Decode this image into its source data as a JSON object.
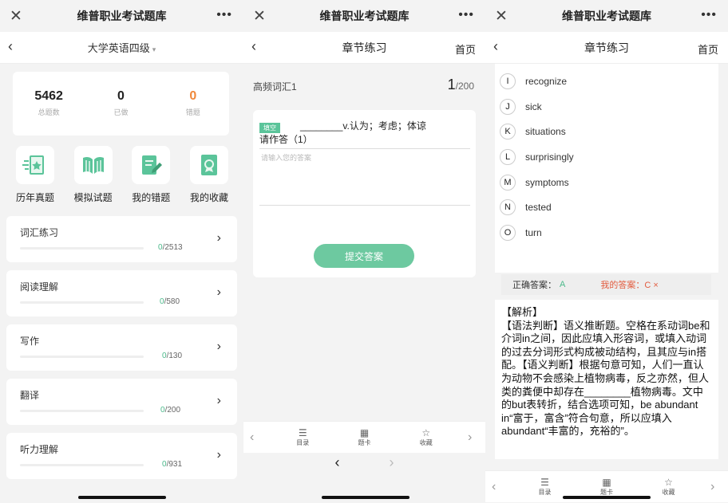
{
  "app_title": "维普职业考试题库",
  "p1": {
    "nav_title": "大学英语四级",
    "stats": [
      {
        "value": "5462",
        "label": "总题数"
      },
      {
        "value": "0",
        "label": "已做"
      },
      {
        "value": "0",
        "label": "错题"
      }
    ],
    "quick": [
      {
        "label": "历年真题",
        "icon": "exam-paper-icon"
      },
      {
        "label": "模拟试题",
        "icon": "book-icon"
      },
      {
        "label": "我的错题",
        "icon": "edit-note-icon"
      },
      {
        "label": "我的收藏",
        "icon": "favorite-badge-icon"
      }
    ],
    "sections": [
      {
        "title": "词汇练习",
        "done": "0",
        "total": "/2513"
      },
      {
        "title": "阅读理解",
        "done": "0",
        "total": "/580"
      },
      {
        "title": "写作",
        "done": "0",
        "total": "/130"
      },
      {
        "title": "翻译",
        "done": "0",
        "total": "/200"
      },
      {
        "title": "听力理解",
        "done": "0",
        "total": "/931"
      }
    ]
  },
  "p2": {
    "nav_title": "章节练习",
    "home": "首页",
    "question_group": "高频词汇1",
    "current": "1",
    "total": "/200",
    "tag": "填空",
    "question": "________v.认为；考虑；体谅",
    "instruction": "请作答（1）",
    "placeholder": "请输入您的答案",
    "submit": "提交答案",
    "bottom": {
      "catalog": "目录",
      "card": "题卡",
      "fav": "收藏"
    }
  },
  "p3": {
    "nav_title": "章节练习",
    "home": "首页",
    "options": [
      {
        "k": "I",
        "t": "recognize"
      },
      {
        "k": "J",
        "t": "sick"
      },
      {
        "k": "K",
        "t": "situations"
      },
      {
        "k": "L",
        "t": "surprisingly"
      },
      {
        "k": "M",
        "t": "symptoms"
      },
      {
        "k": "N",
        "t": "tested"
      },
      {
        "k": "O",
        "t": "turn"
      }
    ],
    "correct_label": "正确答案：",
    "correct": "A",
    "my_label": "我的答案：C ×",
    "analysis": "【解析】\n【语法判断】语义推断题。空格在系动词be和介词in之间，因此应填入形容词，或填入动词的过去分词形式构成被动结构，且其应与in搭配。【语义判断】根据句意可知，人们一直认为动物不会感染上植物病毒，反之亦然，但人类的粪便中却存在________植物病毒。文中的but表转折，结合选项可知，be abundant in“富于，富含”符合句意，所以应填入abundant“丰富的，充裕的”。",
    "bottom": {
      "catalog": "目录",
      "card": "题卡",
      "fav": "收藏"
    }
  },
  "colors": {
    "accent": "#5bc49a",
    "wrong": "#e25c3f",
    "warn": "#f0883a"
  }
}
